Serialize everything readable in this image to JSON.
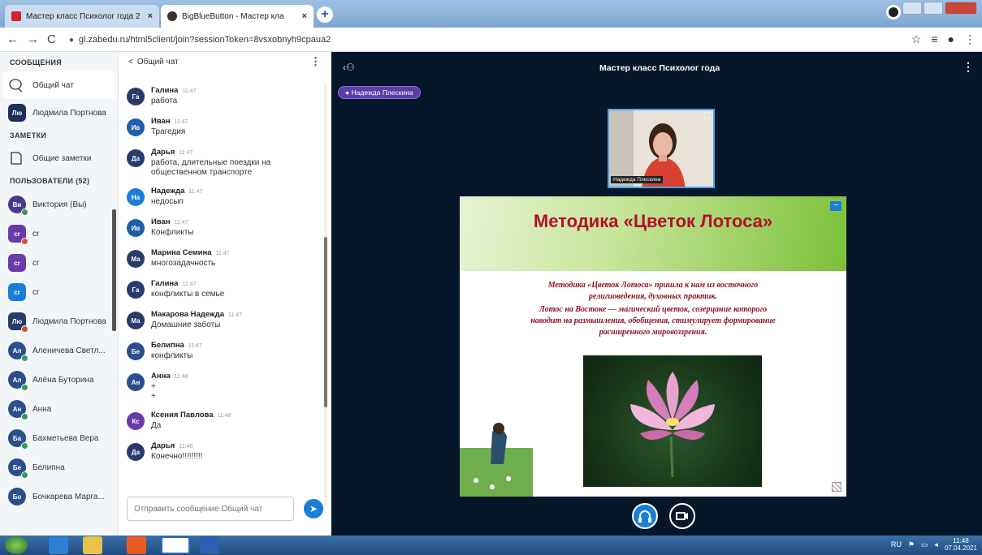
{
  "browser": {
    "tabs": [
      {
        "title": "Мастер класс Психолог года 2с",
        "active": false
      },
      {
        "title": "BigBlueButton - Мастер кла",
        "active": true
      }
    ],
    "url": "gl.zabedu.ru/html5client/join?sessionToken=8vsxobnyh9cpaua2"
  },
  "left": {
    "messages_title": "СООБЩЕНИЯ",
    "public_chat": "Общий чат",
    "private_chat": {
      "initials": "Лю",
      "name": "Людмила Портнова"
    },
    "notes_title": "ЗАМЕТКИ",
    "shared_notes": "Общие заметки",
    "users_title": "ПОЛЬЗОВАТЕЛИ (52)",
    "users": [
      {
        "initials": "Ви",
        "name": "Виктория (Вы)",
        "color": "#4a3a8f",
        "round": true,
        "dot": "#2e9a55"
      },
      {
        "initials": "cr",
        "name": "cr",
        "color": "#6a3aa8",
        "round": false,
        "dot": "#d8502b"
      },
      {
        "initials": "cr",
        "name": "cr",
        "color": "#6a3aa8",
        "round": false,
        "dot": ""
      },
      {
        "initials": "cr",
        "name": "cr",
        "color": "#1b7ed6",
        "round": false,
        "dot": ""
      },
      {
        "initials": "Лю",
        "name": "Людмила Портнова",
        "color": "#2a3b6b",
        "round": false,
        "dot": "#d8502b"
      },
      {
        "initials": "Ал",
        "name": "Аленичева Светл...",
        "color": "#2a4f8a",
        "round": true,
        "dot": "#2e9a55"
      },
      {
        "initials": "Ал",
        "name": "Алёна Буторина",
        "color": "#2a4f8a",
        "round": true,
        "dot": "#2e9a55"
      },
      {
        "initials": "Ан",
        "name": "Анна",
        "color": "#2a4f8a",
        "round": true,
        "dot": "#2e9a55"
      },
      {
        "initials": "Ба",
        "name": "Бахметьева Вера",
        "color": "#2a4f8a",
        "round": true,
        "dot": "#2e9a55"
      },
      {
        "initials": "Бе",
        "name": "Белипна",
        "color": "#2a4f8a",
        "round": true,
        "dot": "#2e9a55"
      },
      {
        "initials": "Бо",
        "name": "Бочкарева Марга...",
        "color": "#2a4f8a",
        "round": true,
        "dot": ""
      }
    ]
  },
  "chat": {
    "title": "Общий чат",
    "back": "<",
    "messages": [
      {
        "initials": "Га",
        "name": "Галина",
        "time": "11:47",
        "lines": [
          "работа"
        ],
        "color": "#2a3b6b"
      },
      {
        "initials": "Ив",
        "name": "Иван",
        "time": "11:47",
        "lines": [
          "Трагедия"
        ],
        "color": "#1f5fa8"
      },
      {
        "initials": "Да",
        "name": "Дарья",
        "time": "11:47",
        "lines": [
          "работа, длительные поездки на",
          "общественном транспорте"
        ],
        "color": "#2a3b6b"
      },
      {
        "initials": "На",
        "name": "Надежда",
        "time": "11:47",
        "lines": [
          "недосып"
        ],
        "color": "#1b7ed6"
      },
      {
        "initials": "Ив",
        "name": "Иван",
        "time": "11:47",
        "lines": [
          "Конфликты"
        ],
        "color": "#1f5fa8"
      },
      {
        "initials": "Ма",
        "name": "Марина Семина",
        "time": "11:47",
        "lines": [
          "многозадачность"
        ],
        "color": "#2a3b6b"
      },
      {
        "initials": "Га",
        "name": "Галина",
        "time": "11:47",
        "lines": [
          "конфликты в семье"
        ],
        "color": "#2a3b6b"
      },
      {
        "initials": "Ма",
        "name": "Макарова Надежда",
        "time": "11:47",
        "lines": [
          "Домашние заботы"
        ],
        "color": "#2a3b6b"
      },
      {
        "initials": "Бе",
        "name": "Белипна",
        "time": "11:47",
        "lines": [
          "конфликты"
        ],
        "color": "#2a4f8a"
      },
      {
        "initials": "Ан",
        "name": "Анна",
        "time": "11:48",
        "lines": [
          "+",
          "+"
        ],
        "color": "#2a4f8a"
      },
      {
        "initials": "Кс",
        "name": "Ксения Павлова",
        "time": "11:48",
        "lines": [
          "Да"
        ],
        "color": "#6a3aa8"
      },
      {
        "initials": "Да",
        "name": "Дарья",
        "time": "11:48",
        "lines": [
          "Конечно!!!!!!!!!"
        ],
        "color": "#2a3b6b"
      }
    ],
    "input_placeholder": "Отправить сообщение Общий чат"
  },
  "main": {
    "meeting_title": "Мастер класс Психолог года",
    "talker": "Надежда Плескина",
    "video_name": "Надежда Плескина",
    "slide": {
      "title": "Методика «Цветок Лотоса»",
      "lines": [
        "Методика «Цветок Лотоса» пришла к нам из восточного",
        "религиоведения, духовных практик.",
        "Лотос на Востоке — магический цветок, созерцание которого",
        "наводит на размышления, обобщения, стимулирует формирование",
        "расширенного мировоззрения."
      ]
    }
  },
  "taskbar": {
    "lang": "RU",
    "time": "11:48",
    "date": "07.04.2021"
  },
  "colors": {
    "accent": "#1b7ed6",
    "main_bg": "#06172a",
    "slide_title": "#b2112a"
  }
}
